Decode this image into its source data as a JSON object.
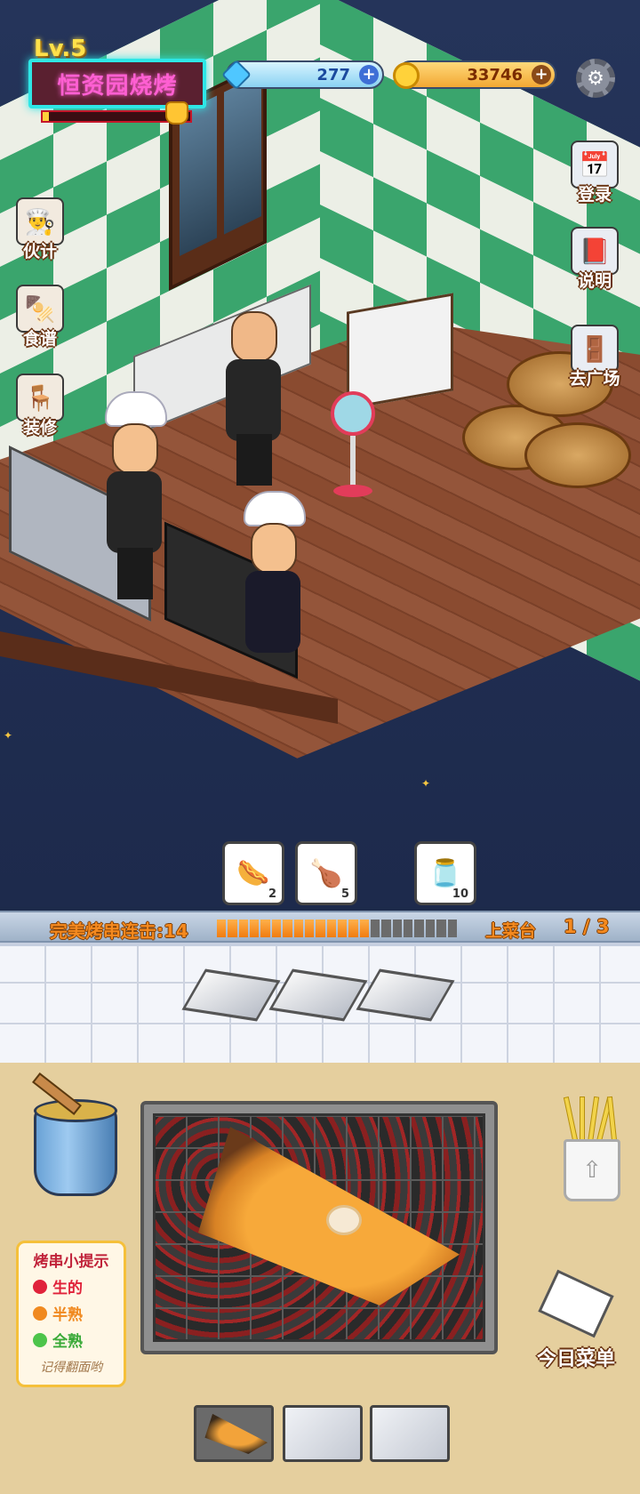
{
  "hud": {
    "level": "Lv.5",
    "shop_name": "恒资园烧烤",
    "xp_progress_fraction": 0.04,
    "gems": "277",
    "coins": "33746",
    "plus_glyph": "+"
  },
  "left_menu": [
    {
      "label": "伙计",
      "icon": "chef-icon"
    },
    {
      "label": "食谱",
      "icon": "skewer-plate-icon"
    },
    {
      "label": "装修",
      "icon": "table-icon"
    }
  ],
  "right_menu": [
    {
      "label": "登录",
      "icon": "calendar-icon"
    },
    {
      "label": "说明",
      "icon": "book-icon"
    },
    {
      "label": "去广场",
      "icon": "door-icon"
    }
  ],
  "orders": [
    {
      "item": "sausage-skewer-icon",
      "count": "2"
    },
    {
      "item": "chicken-wing-icon",
      "count": "5"
    },
    {
      "item": "sauce-jar-icon",
      "count": "10"
    }
  ],
  "combo": {
    "label": "完美烤串连击:14",
    "filled_segments": 14,
    "total_segments": 22,
    "serve_label": "上菜台",
    "serve_count": "1 / 3"
  },
  "tips": {
    "title": "烤串小提示",
    "raw": "生的",
    "half": "半熟",
    "done": "全熟",
    "footer": "记得翻面哟",
    "colors": {
      "raw": "#e0223a",
      "half": "#f0891f",
      "done": "#3aaa38"
    }
  },
  "station": {
    "todays_menu_label": "今日菜单",
    "fries_arrow": "⇧"
  },
  "colors": {
    "sign_border": "#2ee6e6",
    "sign_text": "#ff5fd2",
    "combo_text": "#f58a1f",
    "wall_green": "#3aa56d"
  }
}
